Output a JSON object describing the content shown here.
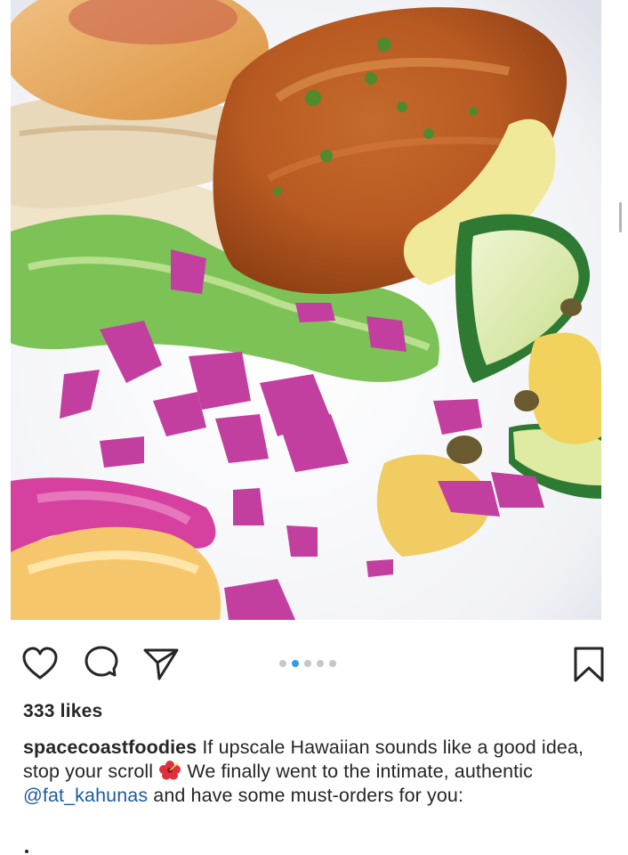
{
  "post": {
    "likes_text": "333 likes",
    "caption": {
      "username": "spacecoastfoodies",
      "text_before_emoji": "If upscale Hawaiian sounds like a good idea, stop your scroll",
      "emoji_icon": "hibiscus-icon",
      "text_after_emoji": "We finally went to the intimate, authentic",
      "mention": "@fat_kahunas",
      "text_after_mention": "and have some must-orders for you:"
    },
    "carousel": {
      "total": 5,
      "active_index": 1
    }
  },
  "icons": {
    "like": "heart-icon",
    "comment": "comment-icon",
    "share": "send-icon",
    "save": "bookmark-icon"
  },
  "colors": {
    "accent": "#3897f0",
    "mention": "#1c5b9c",
    "text": "#262626",
    "dot_inactive": "#c7c7c7"
  }
}
